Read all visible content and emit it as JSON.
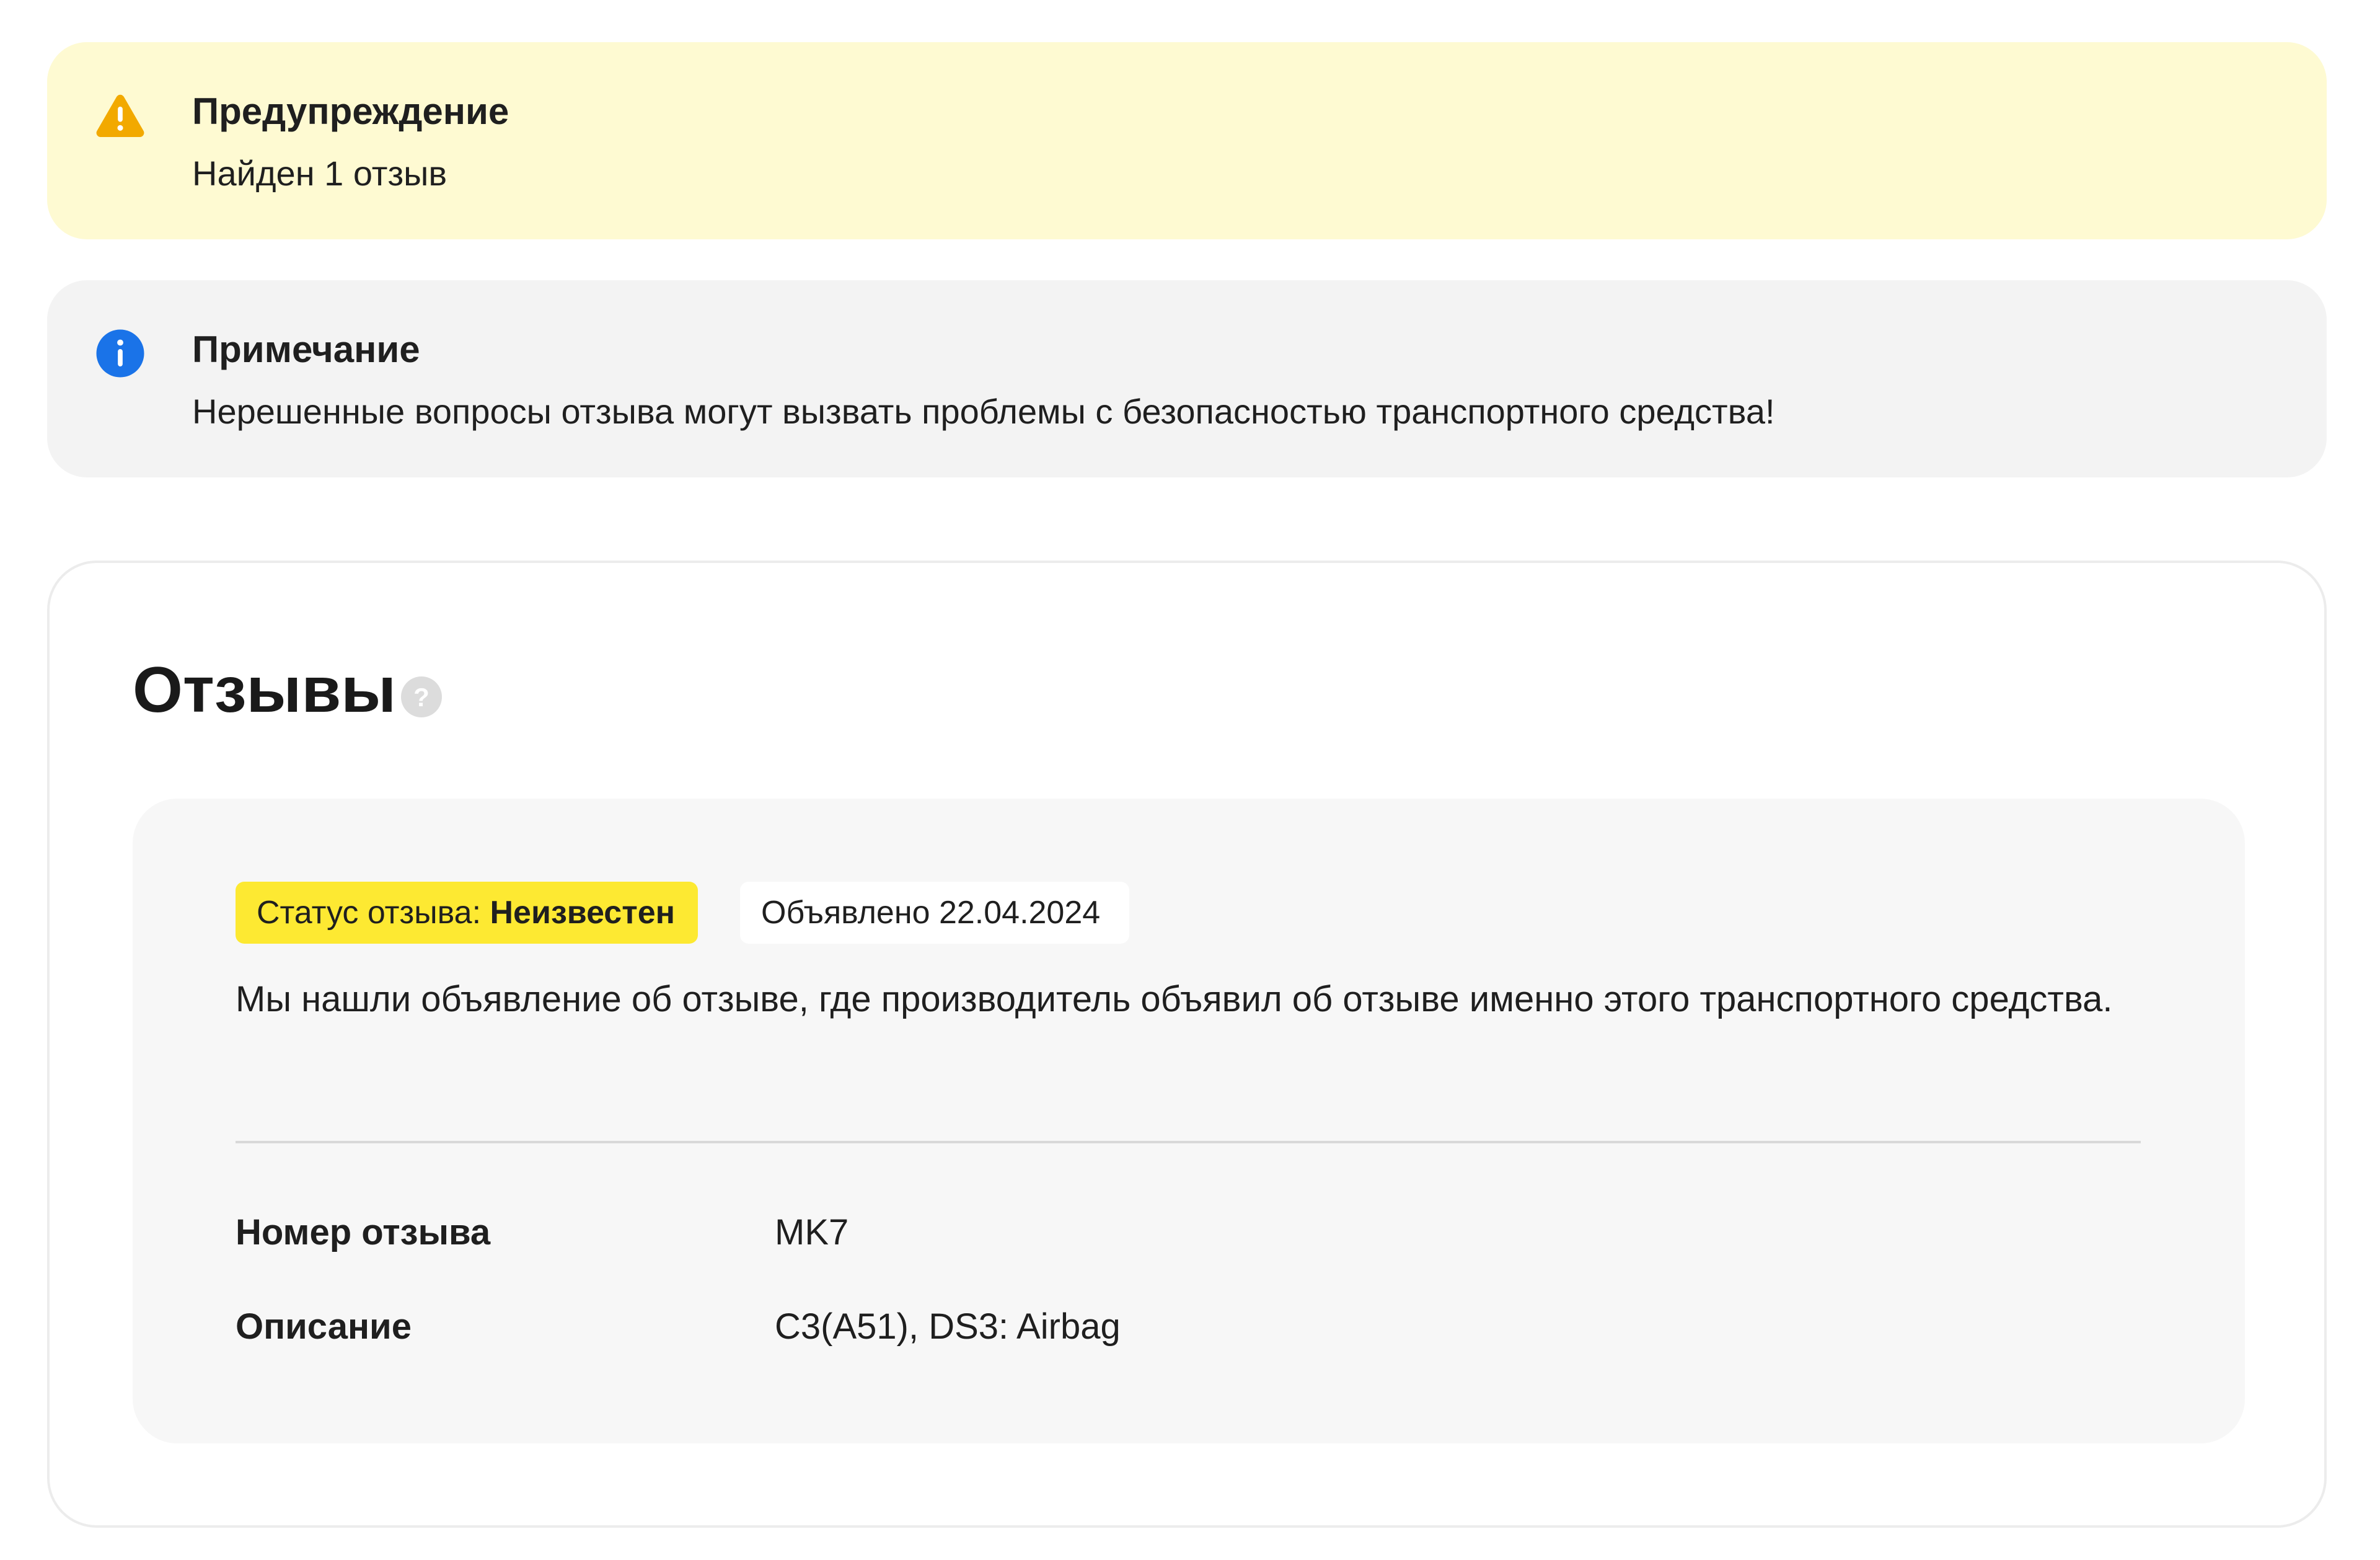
{
  "warning": {
    "icon": "warning-triangle-icon",
    "title": "Предупреждение",
    "text": "Найден 1 отзыв",
    "background": "#fefad2",
    "icon_color": "#f2a900"
  },
  "note": {
    "icon": "info-icon",
    "title": "Примечание",
    "text": "Нерешенные вопросы отзыва могут вызвать проблемы с безопасностью транспортного средства!",
    "background": "#f3f3f3",
    "icon_color": "#1a73e8"
  },
  "recalls": {
    "title": "Отзывы",
    "help_icon": "help-icon",
    "item": {
      "status_label": "Статус отзыва:",
      "status_value": "Неизвестен",
      "status_color": "#fde932",
      "announced": "Объявлено 22.04.2024",
      "description": "Мы нашли объявление об отзыве, где производитель объявил об отзыве именно этого транспортного средства.",
      "fields": [
        {
          "label": "Номер отзыва",
          "value": "MK7"
        },
        {
          "label": "Описание",
          "value": "C3(A51), DS3: Airbag"
        }
      ]
    }
  }
}
